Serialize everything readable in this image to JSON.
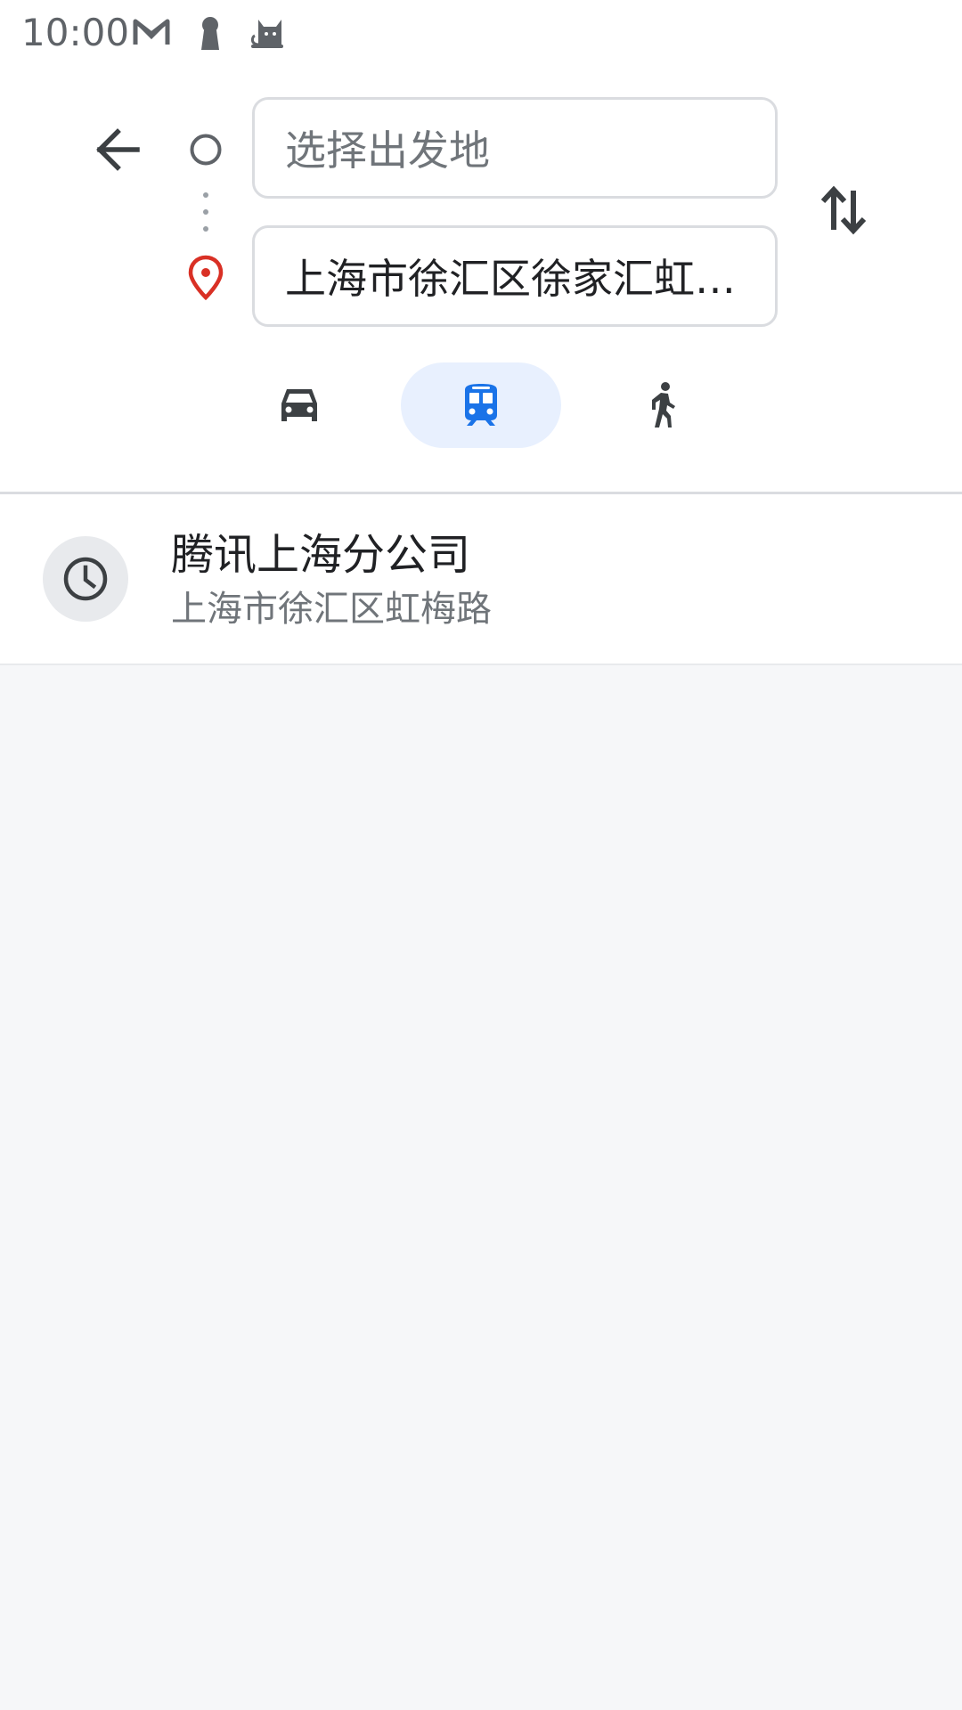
{
  "status_bar": {
    "time": "10:00",
    "icons": [
      "gmail-icon",
      "keyhole-icon",
      "cat-icon"
    ]
  },
  "route": {
    "origin_placeholder": "选择出发地",
    "destination_value": "上海市徐汇区徐家汇虹…"
  },
  "modes": [
    {
      "name": "car-icon",
      "selected": false
    },
    {
      "name": "train-icon",
      "selected": true
    },
    {
      "name": "walk-icon",
      "selected": false
    }
  ],
  "recent": [
    {
      "title": "腾讯上海分公司",
      "subtitle": "上海市徐汇区虹梅路",
      "icon": "clock-icon"
    }
  ],
  "colors": {
    "accent": "#1a73e8",
    "accent_bg": "#e8f0fe",
    "destination_pin": "#d93025",
    "icon_dark": "#3c4043",
    "background": "#f6f7f9"
  }
}
